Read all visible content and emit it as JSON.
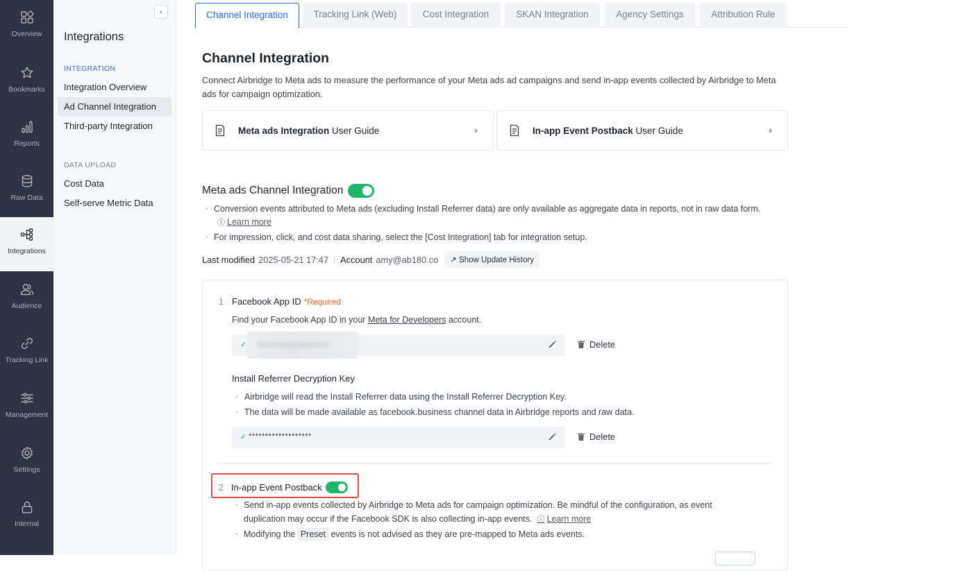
{
  "rail": {
    "items": [
      {
        "label": "Overview",
        "icon": "overview-grid-icon"
      },
      {
        "label": "Bookmarks",
        "icon": "star-icon"
      },
      {
        "label": "Reports",
        "icon": "bar-chart-icon"
      },
      {
        "label": "Raw Data",
        "icon": "database-icon"
      },
      {
        "label": "Integrations",
        "icon": "integration-tree-icon",
        "active": true
      },
      {
        "label": "Audience",
        "icon": "users-icon"
      },
      {
        "label": "Tracking Link",
        "icon": "link-icon"
      },
      {
        "label": "Management",
        "icon": "sliders-icon"
      },
      {
        "label": "Settings",
        "icon": "gear-icon"
      },
      {
        "label": "Internal",
        "icon": "lock-icon"
      }
    ]
  },
  "subnav": {
    "collapse_glyph": "‹",
    "title": "Integrations",
    "section_integration": "INTEGRATION",
    "section_upload": "DATA UPLOAD",
    "items": [
      {
        "label": "Integration Overview"
      },
      {
        "label": "Ad Channel Integration",
        "active": true
      },
      {
        "label": "Third-party Integration"
      },
      {
        "label": "Cost Data"
      },
      {
        "label": "Self-serve Metric Data"
      }
    ]
  },
  "tabs": [
    {
      "label": "Channel Integration",
      "active": true
    },
    {
      "label": "Tracking Link (Web)"
    },
    {
      "label": "Cost Integration"
    },
    {
      "label": "SKAN Integration"
    },
    {
      "label": "Agency Settings"
    },
    {
      "label": "Attribution Rule"
    }
  ],
  "main": {
    "title": "Channel Integration",
    "description": "Connect Airbridge to Meta ads to measure the performance of your Meta ads ad campaigns and send in-app events collected by Airbridge to Meta ads for campaign optimization.",
    "guides": [
      {
        "bold": "Meta ads Integration",
        "rest": " User Guide",
        "chevron": "›"
      },
      {
        "bold": "In-app Event Postback",
        "rest": " User Guide",
        "chevron": "›"
      }
    ],
    "section_title": "Meta ads Channel Integration",
    "section_toggle_on": true,
    "bullets": [
      "Conversion events attributed to Meta ads (excluding Install Referrer data) are only available as aggregate data in reports, not in raw data form.",
      "For impression, click, and cost data sharing, select the [Cost Integration] tab for integration setup."
    ],
    "learn_more": "Learn more",
    "help_glyph": "ⓘ",
    "modified": {
      "label": "Last modified",
      "time": "2025-05-21 17:47",
      "account_label": "Account",
      "account": "amy@ab180.co",
      "history_btn": "↗ Show Update History"
    },
    "step1": {
      "number": "1",
      "title": "Facebook App ID",
      "required": "*Required",
      "desc_prefix": "Find your Facebook App ID in your ",
      "desc_link": "Meta for Developers",
      "desc_suffix": " account.",
      "check_glyph": "✓",
      "delete_label": "Delete"
    },
    "referrer": {
      "title": "Install Referrer Decryption Key",
      "bullets": [
        "Airbridge will read the Install Referrer data using the Install Referrer Decryption Key.",
        "The data will be made available as facebook.business channel data in Airbridge reports and raw data."
      ],
      "masked_value": "*******************",
      "check_glyph": "✓",
      "delete_label": "Delete"
    },
    "step2": {
      "number": "2",
      "title": "In-app Event Postback",
      "toggle_on": true,
      "bullet1": "Send in-app events collected by Airbridge to Meta ads for campaign optimization. Be mindful of the configuration, as event duplication may occur if the Facebook SDK is also collecting in-app events.",
      "learn_more": "Learn more",
      "bullet2_prefix": "Modifying the ",
      "preset": "Preset",
      "bullet2_suffix": " events is not advised as they are pre-mapped to Meta ads events."
    }
  },
  "colors": {
    "rail_bg": "#2f3540",
    "accent": "#2d6ae0",
    "toggle_on": "#23b46c",
    "required": "#e8632b",
    "highlight": "#e5484d"
  }
}
